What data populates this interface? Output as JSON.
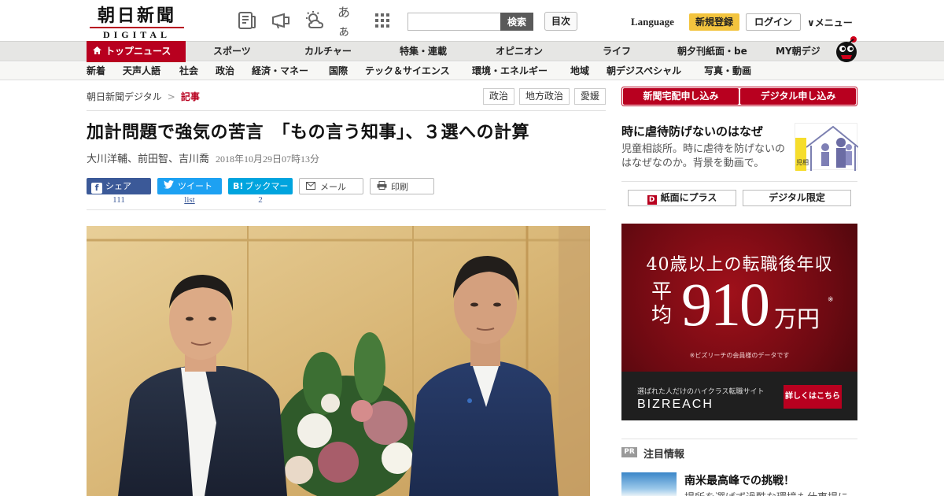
{
  "header": {
    "logo_jp": "朝日新聞",
    "logo_en": "DIGITAL",
    "icons": [
      "newspaper-icon",
      "megaphone-icon",
      "weather-icon",
      "font-size-icon",
      "app-grid-icon"
    ],
    "font_icon_text": "あぁ",
    "search_placeholder": "",
    "search_button": "検索",
    "contents_button": "目次",
    "language": "Language",
    "register": "新規登録",
    "login": "ログイン",
    "menu": "∨メニュー"
  },
  "nav_primary": {
    "top": "トップニュース",
    "items": [
      "スポーツ",
      "カルチャー",
      "特集・連載",
      "オピニオン",
      "ライフ",
      "朝夕刊紙面・be",
      "MY朝デジ"
    ]
  },
  "nav_secondary": {
    "items": [
      "新着",
      "天声人語",
      "社会",
      "政治",
      "経済・マネー",
      "国際",
      "テック＆サイエンス",
      "環境・エネルギー",
      "地域",
      "朝デジスペシャル",
      "写真・動画"
    ]
  },
  "breadcrumb": {
    "home": "朝日新聞デジタル",
    "separator": ">",
    "current": "記事"
  },
  "tags": [
    "政治",
    "地方政治",
    "愛媛"
  ],
  "article": {
    "headline": "加計問題で強気の苦言　「もの言う知事」、３選への計算",
    "authors": "大川洋輔、前田智、吉川喬",
    "date": "2018年10月29日07時13分"
  },
  "share": {
    "facebook": {
      "label": "シェア",
      "count": "111"
    },
    "twitter": {
      "label": "ツイート",
      "count": "list"
    },
    "hatena": {
      "label": "ブックマーク",
      "count": "2",
      "icon_text": "B!"
    },
    "mail": {
      "label": "メール"
    },
    "print": {
      "label": "印刷"
    }
  },
  "sidebar": {
    "subscribe_buttons": [
      "新聞宅配申し込み",
      "デジタル申し込み"
    ],
    "feature": {
      "title": "時に虐待防げないのはなぜ",
      "desc": "児童相談所。時に虐待を防げないのはなぜなのか。背景を動画で。",
      "sign_text": "児相"
    },
    "buttons": [
      "紙面にプラス",
      "デジタル限定"
    ],
    "ad": {
      "line1": "40歳以上の転職後年収",
      "avg": "平均",
      "number": "910",
      "unit": "万円",
      "star": "※",
      "note": "※ビズリーチの会員様のデータです",
      "site": "選ばれた人だけのハイクラス転職サイト",
      "brand": "BIZREACH",
      "cta": "詳しくはこちら"
    },
    "pr": {
      "badge": "PR",
      "title": "注目情報",
      "headline": "南米最高峰での挑戦！",
      "sub": "場所を選ばず過酷な環境も仕事場に"
    }
  },
  "colors": {
    "brand_red": "#b8001f",
    "facebook": "#3b5998",
    "twitter": "#1da1f2",
    "hatena": "#00a4de",
    "register_yellow": "#f3c43e"
  }
}
